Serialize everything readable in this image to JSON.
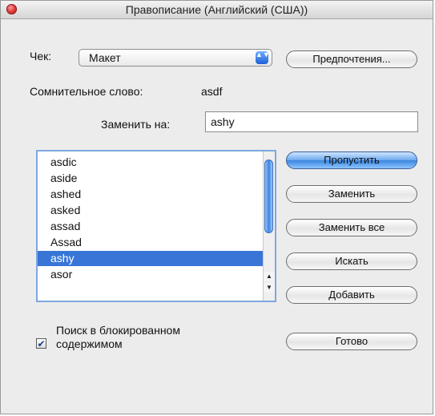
{
  "window": {
    "title": "Правописание (Английский (США))"
  },
  "check": {
    "label": "Чек:",
    "selected_value": "Макет",
    "arrows": "▲▼"
  },
  "buttons": {
    "preferences": "Предпочтения...",
    "skip": "Пропустить",
    "replace": "Заменить",
    "replace_all": "Заменить все",
    "find": "Искать",
    "add": "Добавить",
    "done": "Готово"
  },
  "misspelled": {
    "label": "Сомнительное слово:",
    "word": "asdf"
  },
  "replace_with": {
    "label": "Заменить на:",
    "value": "ashy"
  },
  "suggestions": {
    "items": [
      "asdic",
      "aside",
      "ashed",
      "asked",
      "assad",
      "Assad",
      "ashy",
      "asor"
    ],
    "selected": "ashy"
  },
  "scroll": {
    "up_arrow": "▲",
    "down_arrow": "▼"
  },
  "search_locked": {
    "checked": true,
    "mark": "✔",
    "label_line1": "Поиск в блокированном",
    "label_line2": "содержимом"
  }
}
